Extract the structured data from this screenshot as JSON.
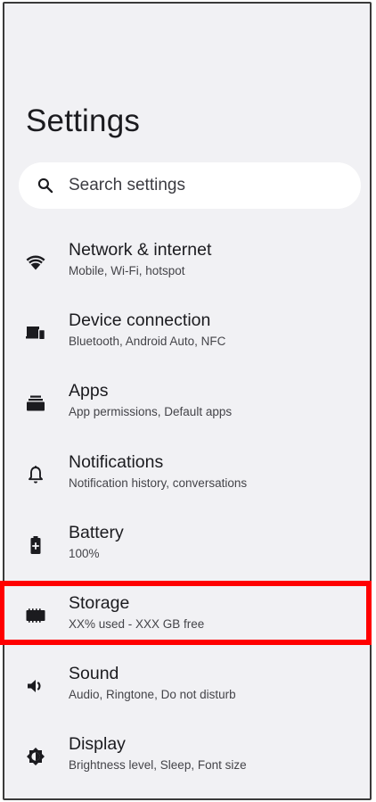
{
  "page": {
    "title": "Settings"
  },
  "search": {
    "placeholder": "Search settings",
    "icon": "search-icon"
  },
  "settings_items": [
    {
      "title": "Network & internet",
      "summary": "Mobile, Wi-Fi, hotspot",
      "icon": "wifi-icon"
    },
    {
      "title": "Device connection",
      "summary": "Bluetooth, Android Auto, NFC",
      "icon": "devices-icon"
    },
    {
      "title": "Apps",
      "summary": "App permissions, Default apps",
      "icon": "apps-icon"
    },
    {
      "title": "Notifications",
      "summary": "Notification history, conversations",
      "icon": "bell-icon"
    },
    {
      "title": "Battery",
      "summary": "100%",
      "icon": "battery-icon"
    },
    {
      "title": "Storage",
      "summary": "XX% used - XXX GB free",
      "icon": "storage-icon"
    },
    {
      "title": "Sound",
      "summary": "Audio, Ringtone, Do not disturb",
      "icon": "volume-icon"
    },
    {
      "title": "Display",
      "summary": "Brightness level, Sleep, Font size",
      "icon": "brightness-icon"
    }
  ],
  "highlighted_item": "Storage",
  "colors": {
    "background": "#f1f1f4",
    "highlight": "#ff0000",
    "text": "#1b1b1f"
  }
}
